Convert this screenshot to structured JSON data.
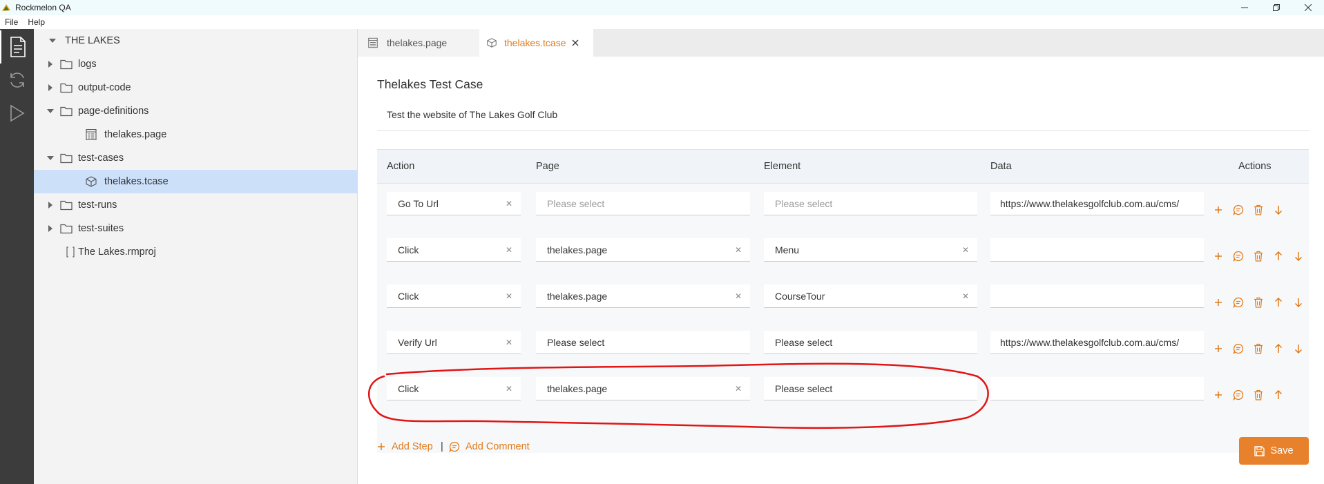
{
  "window": {
    "title": "Rockmelon QA",
    "accent": "#e07a1a",
    "annotation_color": "#e21515"
  },
  "menu": {
    "file": "File",
    "help": "Help"
  },
  "activity_bar": {
    "icons": [
      "explorer-icon",
      "sync-icon",
      "run-icon"
    ]
  },
  "explorer": {
    "root": "THE LAKES",
    "items": [
      {
        "label": "logs",
        "type": "folder",
        "expanded": false
      },
      {
        "label": "output-code",
        "type": "folder",
        "expanded": false
      },
      {
        "label": "page-definitions",
        "type": "folder",
        "expanded": true
      },
      {
        "label": "thelakes.page",
        "type": "page-file"
      },
      {
        "label": "test-cases",
        "type": "folder",
        "expanded": true
      },
      {
        "label": "thelakes.tcase",
        "type": "tcase-file",
        "selected": true
      },
      {
        "label": "test-runs",
        "type": "folder",
        "expanded": false
      },
      {
        "label": "test-suites",
        "type": "folder",
        "expanded": false
      },
      {
        "label": "The Lakes.rmproj",
        "type": "project-file"
      }
    ]
  },
  "tabs": [
    {
      "label": "thelakes.page",
      "active": false
    },
    {
      "label": "thelakes.tcase",
      "active": true
    }
  ],
  "editor": {
    "title": "Thelakes Test Case",
    "description": "Test the website of The Lakes Golf Club",
    "columns": {
      "action": "Action",
      "page": "Page",
      "element": "Element",
      "data": "Data",
      "actions": "Actions"
    },
    "steps": [
      {
        "action": "Go To Url",
        "page": "Please select",
        "element": "Please select",
        "data": "https://www.thelakesgolfclub.com.au/cms/"
      },
      {
        "action": "Click",
        "page": "thelakes.page",
        "element": "Menu",
        "data": ""
      },
      {
        "action": "Click",
        "page": "thelakes.page",
        "element": "CourseTour",
        "data": ""
      },
      {
        "action": "Verify Url",
        "page": "Please select",
        "element": "Please select",
        "data": "https://www.thelakesgolfclub.com.au/cms/"
      },
      {
        "action": "Click",
        "page": "thelakes.page",
        "element": "Please select",
        "data": ""
      }
    ],
    "add_step": "Add Step",
    "separator": "|",
    "add_comment": "Add Comment",
    "save": "Save"
  }
}
